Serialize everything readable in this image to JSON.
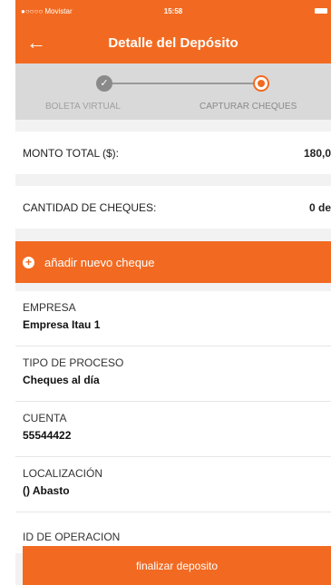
{
  "status_bar": {
    "carrier": "●○○○○ Movistar",
    "time": "15:58"
  },
  "header": {
    "back_icon": "arrow-left-icon",
    "title": "Detalle del Depósito"
  },
  "stepper": {
    "steps": [
      {
        "label": "BOLETA VIRTUAL",
        "state": "done",
        "check": "✓"
      },
      {
        "label": "CAPTURAR CHEQUES",
        "state": "current"
      }
    ]
  },
  "summary": {
    "monto_label": "MONTO TOTAL ($):",
    "monto_value": "180,0",
    "cantidad_label": "CANTIDAD DE CHEQUES:",
    "cantidad_value": "0 de"
  },
  "add_cheque": {
    "label": "añadir nuevo cheque",
    "icon": "plus-circle-icon"
  },
  "details": [
    {
      "key": "EMPRESA",
      "value": "Empresa Itau 1"
    },
    {
      "key": "TIPO DE PROCESO",
      "value": "Cheques al día"
    },
    {
      "key": "CUENTA",
      "value": "55544422"
    },
    {
      "key": "LOCALIZACIÓN",
      "value": "() Abasto"
    },
    {
      "key": "ID DE OPERACION",
      "value": ""
    }
  ],
  "footer": {
    "finalize_label": "finalizar deposito"
  },
  "colors": {
    "accent": "#f26a21",
    "stepper_bg": "#d9d9d9",
    "page_bg": "#f2f2f2"
  }
}
